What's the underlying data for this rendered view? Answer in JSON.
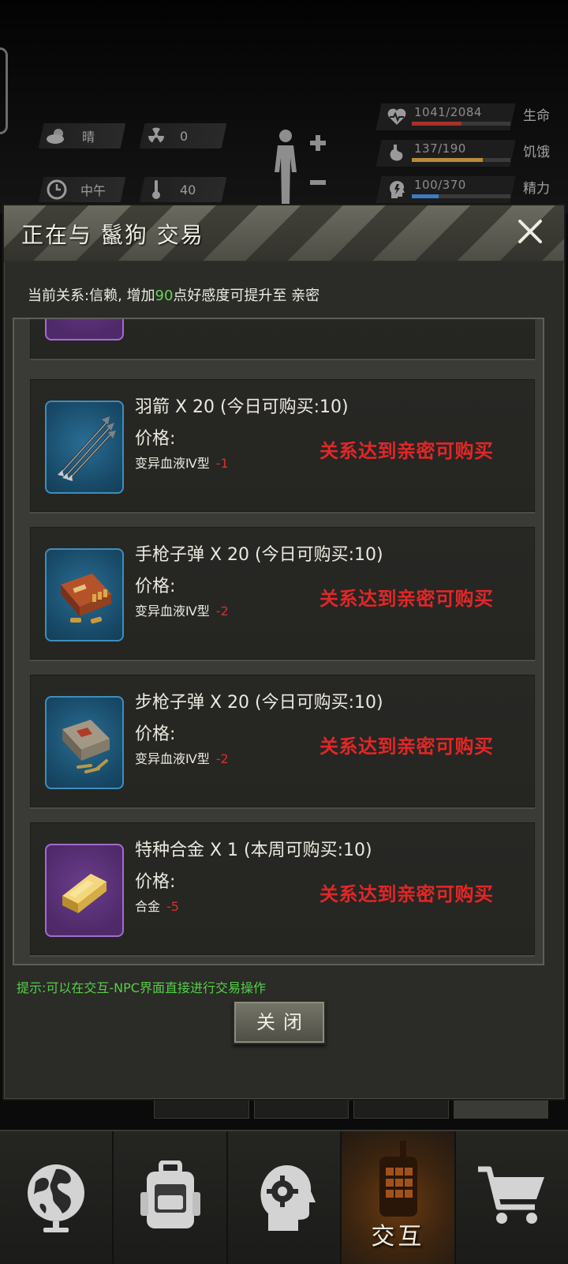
{
  "hud": {
    "weather": "晴",
    "radiation": "0",
    "time_of_day": "中午",
    "temperature": "40",
    "stats": [
      {
        "value": "1041/2084",
        "label": "生命",
        "fill": 0.5,
        "color": "#a8322b",
        "icon": "heart-pulse-icon"
      },
      {
        "value": "137/190",
        "label": "饥饿",
        "fill": 0.72,
        "color": "#b98a3a",
        "icon": "stomach-icon"
      },
      {
        "value": "100/370",
        "label": "精力",
        "fill": 0.27,
        "color": "#3b7cc4",
        "icon": "head-energy-icon"
      }
    ]
  },
  "dialog": {
    "title": "正在与 鬣狗 交易",
    "relation_prefix": "当前关系:信赖, 增加",
    "relation_points": "90",
    "relation_suffix": "点好感度可提升至 亲密",
    "price_label": "价格:",
    "items": [
      {
        "name": "羽箭 X 20 (今日可购买:10)",
        "cost_item": "变异血液Ⅳ型",
        "cost_amount": "-1",
        "lock_text": "关系达到亲密可购买",
        "icon": "arrows-icon",
        "frame": "blue"
      },
      {
        "name": "手枪子弹 X 20 (今日可购买:10)",
        "cost_item": "变异血液Ⅳ型",
        "cost_amount": "-2",
        "lock_text": "关系达到亲密可购买",
        "icon": "pistol-ammo-box-icon",
        "frame": "blue"
      },
      {
        "name": "步枪子弹 X 20 (今日可购买:10)",
        "cost_item": "变异血液Ⅳ型",
        "cost_amount": "-2",
        "lock_text": "关系达到亲密可购买",
        "icon": "rifle-ammo-box-icon",
        "frame": "blue"
      },
      {
        "name": "特种合金 X 1 (本周可购买:10)",
        "cost_item": "合金",
        "cost_amount": "-5",
        "lock_text": "关系达到亲密可购买",
        "icon": "gold-ingot-icon",
        "frame": "purple"
      }
    ],
    "hint": "提示:可以在交互-NPC界面直接进行交易操作",
    "close_label": "关闭"
  },
  "bottom_nav": {
    "items": [
      {
        "icon": "globe-icon",
        "label": ""
      },
      {
        "icon": "backpack-icon",
        "label": ""
      },
      {
        "icon": "head-gear-icon",
        "label": ""
      },
      {
        "icon": "walkie-talkie-icon",
        "label": "交互"
      },
      {
        "icon": "shopping-cart-icon",
        "label": ""
      }
    ],
    "active_index": 3
  }
}
